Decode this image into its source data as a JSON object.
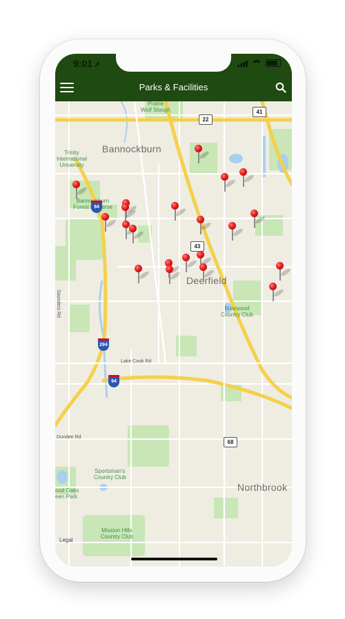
{
  "status_bar": {
    "time": "9:01"
  },
  "nav": {
    "title": "Parks & Facilities"
  },
  "map": {
    "towns": {
      "bannockburn": "Bannockburn",
      "deerfield": "Deerfield",
      "northbrook": "Northbrook"
    },
    "places": {
      "prairie_wolf": "Prairie\nWolf Slough",
      "trinity": "Trinity\nInternational\nUniversity",
      "bannockburn_fp": "Bannockburn\nForest Preserve",
      "briarwood": "Briarwood\nCountry Club",
      "sportsmans": "Sportsman's\nCountry Club",
      "wood_oaks": "ood Oaks\neen Park",
      "mission_hills": "Mission Hills\nCountry Club"
    },
    "roads": {
      "saunders": "Saunders Rd",
      "lake_cook": "Lake Cook Rd",
      "dundee": "Dundee Rd"
    },
    "shields": {
      "us41": "41",
      "r22": "22",
      "r43": "43",
      "r68": "68",
      "i94_top": "94",
      "i294": "294",
      "i94_bottom": "94"
    },
    "legal": "Legal",
    "pin_count": 21
  },
  "colors": {
    "header": "#1f4a12",
    "pin": "#e51c1c",
    "park": "#c6e3b4",
    "highway": "#f7d34a",
    "water": "#a9d0f0"
  }
}
